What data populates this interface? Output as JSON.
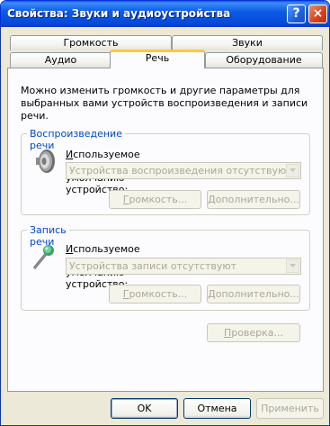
{
  "window": {
    "title": "Свойства: Звуки и аудиоустройства",
    "help_glyph": "?",
    "close_glyph": "×"
  },
  "tabs_back": [
    {
      "label": "Громкость"
    },
    {
      "label": "Звуки"
    }
  ],
  "tabs_front": [
    {
      "label": "Аудио"
    },
    {
      "label": "Речь"
    },
    {
      "label": "Оборудование"
    }
  ],
  "description": "Можно изменить громкость и другие параметры для выбранных вами устройств воспроизведения и записи речи.",
  "playback": {
    "group_title": "Воспроизведение речи",
    "device_label_u": "И",
    "device_label_rest": "спользуемое по умолчанию устройство:",
    "device_value": "Устройства воспроизведения отсутствуют",
    "volume_u": "Г",
    "volume_rest": "ромкость...",
    "advanced_u": "Д",
    "advanced_rest": "ополнительно..."
  },
  "recording": {
    "group_title": "Запись речи",
    "device_label_u": "И",
    "device_label_rest": "спользуемое по умолчанию устройство:",
    "device_value": "Устройства записи отсутствуют",
    "volume_u": "Г",
    "volume_rest": "ромкость...",
    "advanced_u": "Д",
    "advanced_rest": "ополнительно..."
  },
  "test_u": "П",
  "test_rest": "роверка...",
  "footer": {
    "ok": "OK",
    "cancel": "Отмена",
    "apply": "Применить"
  },
  "colors": {
    "titlebar": "#0a5fe0",
    "group_title": "#0046d5",
    "tab_active_accent": "#ffc83c",
    "disabled_text": "#aca899"
  },
  "icons": {
    "playback": "speaker-icon",
    "recording": "microphone-icon"
  }
}
